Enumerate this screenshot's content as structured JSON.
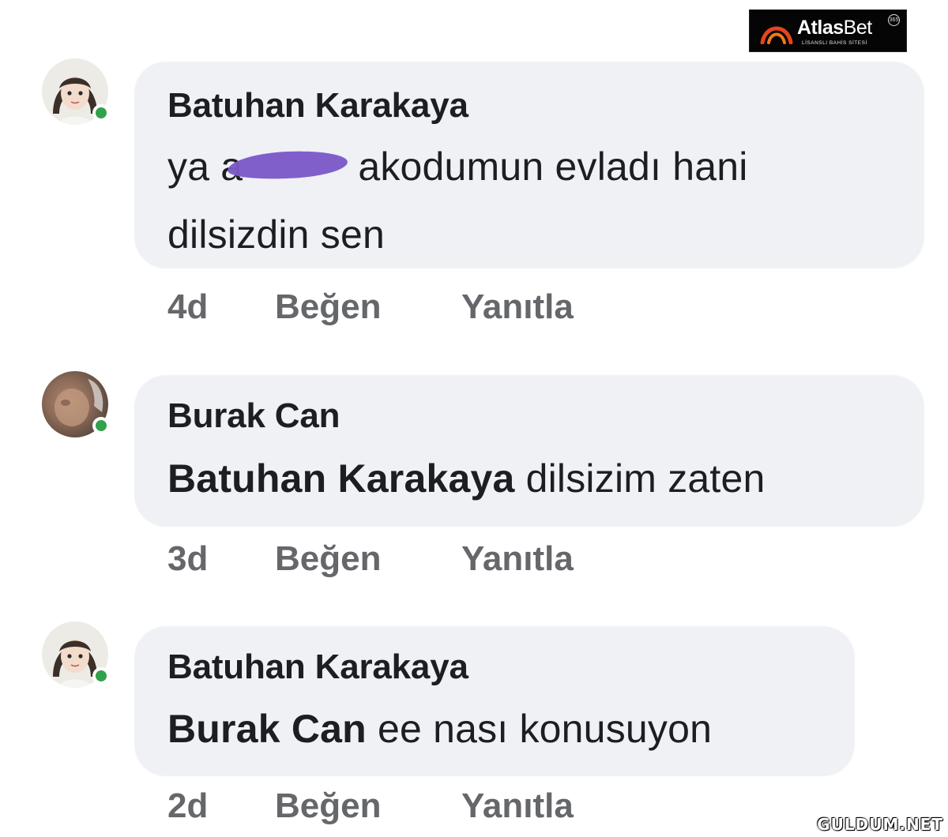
{
  "logo": {
    "brand_part1": "Atlas",
    "brand_part2": "Bet",
    "badge": "365",
    "tagline": "LİSANSLI BAHİS SİTESİ"
  },
  "comments": [
    {
      "author": "Batuhan Karakaya",
      "text_line1_before": "ya a",
      "text_line1_after": "akodumun evladı hani",
      "text_line2": "dilsizdin sen",
      "time": "4d",
      "like_label": "Beğen",
      "reply_label": "Yanıtla",
      "avatar_icon": "cartoon-girl-avatar"
    },
    {
      "author": "Burak Can",
      "mention": "Batuhan Karakaya",
      "text": " dilsizim zaten",
      "time": "3d",
      "like_label": "Beğen",
      "reply_label": "Yanıtla",
      "avatar_icon": "photo-avatar"
    },
    {
      "author": "Batuhan Karakaya",
      "mention": "Burak Can",
      "text": " ee nası konusuyon",
      "time": "2d",
      "like_label": "Beğen",
      "reply_label": "Yanıtla",
      "avatar_icon": "cartoon-girl-avatar"
    }
  ],
  "watermark": "GULDUM.NET",
  "colors": {
    "bubble": "#eff1f5",
    "online": "#31a24c",
    "meta_text": "#65676b",
    "censor": "#7b58c9"
  }
}
